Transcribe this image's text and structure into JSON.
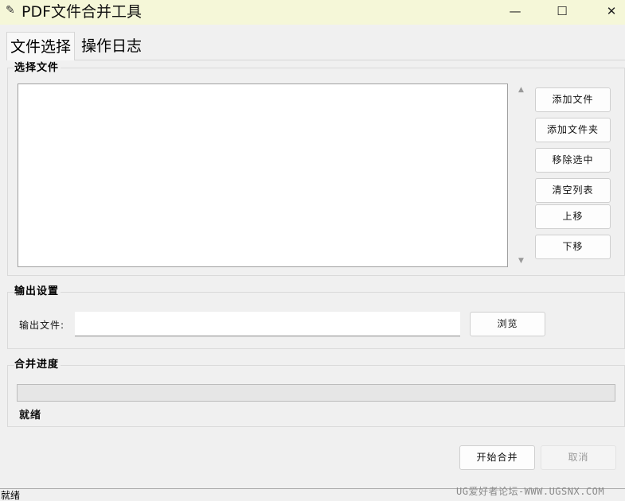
{
  "window": {
    "title": "PDF文件合并工具",
    "icon": "feather-icon",
    "controls": {
      "minimize": "—",
      "maximize": "☐",
      "close": "✕"
    }
  },
  "tabs": [
    {
      "label": "文件选择",
      "active": true
    },
    {
      "label": "操作日志",
      "active": false
    }
  ],
  "file_section": {
    "title": "选择文件",
    "files": [],
    "buttons": {
      "add_file": "添加文件",
      "add_folder": "添加文件夹",
      "remove_selected": "移除选中",
      "clear_list": "清空列表",
      "move_up": "上移",
      "move_down": "下移"
    }
  },
  "output_section": {
    "title": "输出设置",
    "output_label": "输出文件:",
    "output_value": "",
    "browse": "浏览"
  },
  "progress_section": {
    "title": "合并进度",
    "progress": 0,
    "status": "就绪"
  },
  "actions": {
    "start": "开始合并",
    "cancel": "取消"
  },
  "statusbar": {
    "text": "就绪"
  },
  "watermark": "UG爱好者论坛-WWW.UGSNX.COM"
}
